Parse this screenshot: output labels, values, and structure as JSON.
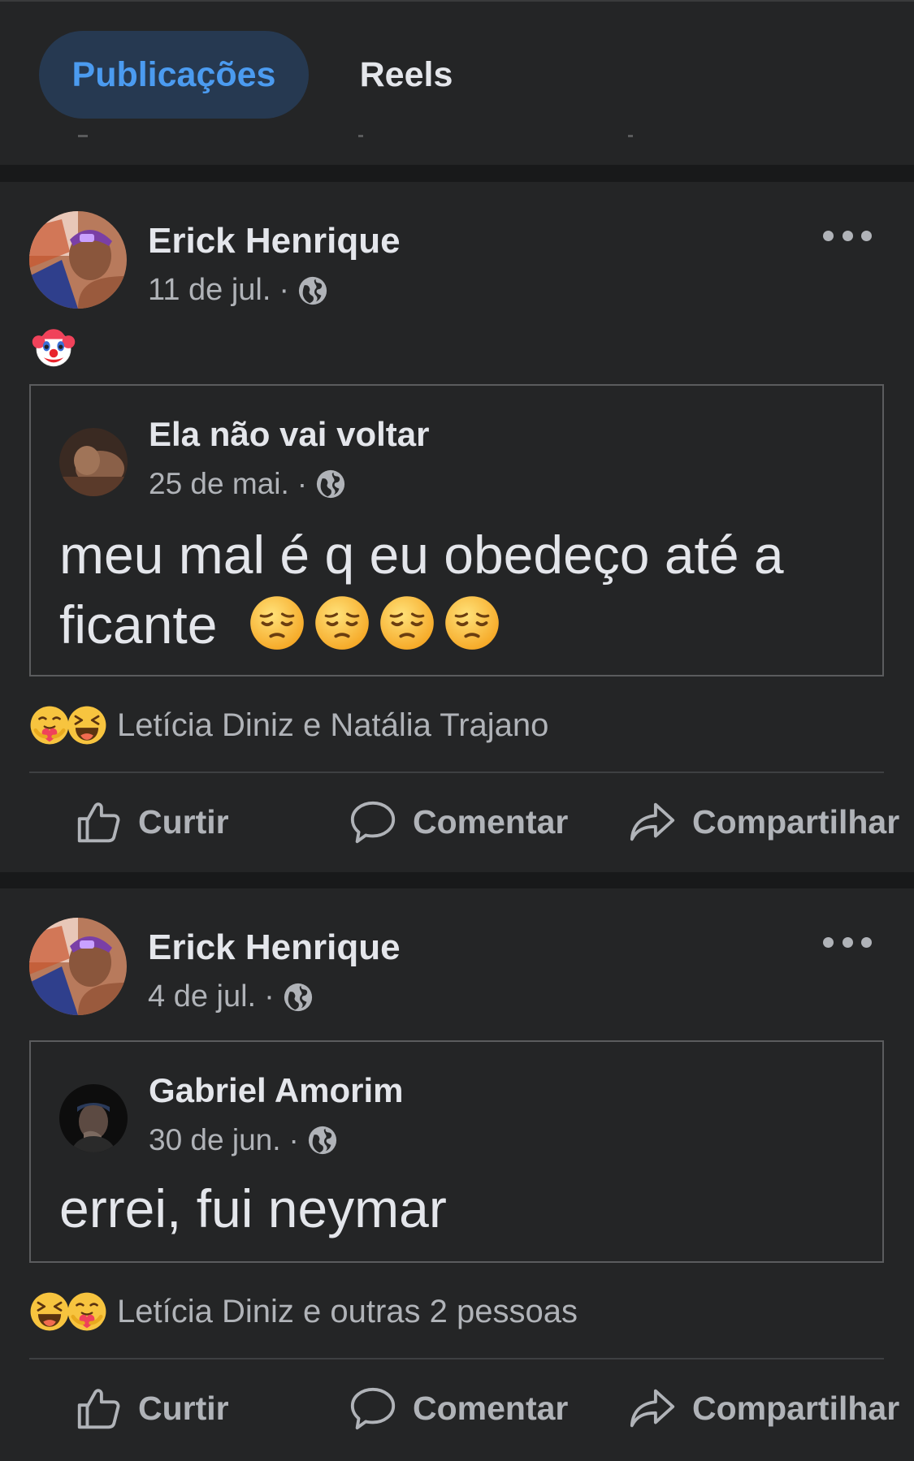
{
  "tabs": [
    {
      "label": "Publicações",
      "active": true
    },
    {
      "label": "Reels",
      "active": false
    }
  ],
  "colors": {
    "background": "#18191a",
    "card": "#242526",
    "accent": "#4b9bf0",
    "tab_active_bg": "#263951",
    "text_primary": "#e4e6eb",
    "text_secondary": "#b0b3b8"
  },
  "posts": [
    {
      "author": "Erick Henrique",
      "date": "11 de jul.",
      "separator": "·",
      "privacy_icon": "globe-icon",
      "body_emoji": "clown-face-emoji",
      "shared": {
        "author": "Ela não vai voltar",
        "date": "25 de mai.",
        "separator": "·",
        "text": "meu mal é q eu obedeço até a ficante",
        "trailing_emoji": [
          "pensive-face-emoji",
          "pensive-face-emoji",
          "pensive-face-emoji",
          "pensive-face-emoji"
        ]
      },
      "reaction_icons": [
        "care-reaction-icon",
        "haha-reaction-icon"
      ],
      "reactions_text": "Letícia Diniz e Natália Trajano",
      "actions": {
        "like": "Curtir",
        "comment": "Comentar",
        "share": "Compartilhar"
      }
    },
    {
      "author": "Erick Henrique",
      "date": "4 de jul.",
      "separator": "·",
      "privacy_icon": "globe-icon",
      "shared": {
        "author": "Gabriel Amorim",
        "date": "30 de jun.",
        "separator": "·",
        "text": "errei, fui neymar"
      },
      "reaction_icons": [
        "haha-reaction-icon",
        "care-reaction-icon"
      ],
      "reactions_text": "Letícia Diniz e outras 2 pessoas",
      "actions": {
        "like": "Curtir",
        "comment": "Comentar",
        "share": "Compartilhar"
      }
    }
  ]
}
